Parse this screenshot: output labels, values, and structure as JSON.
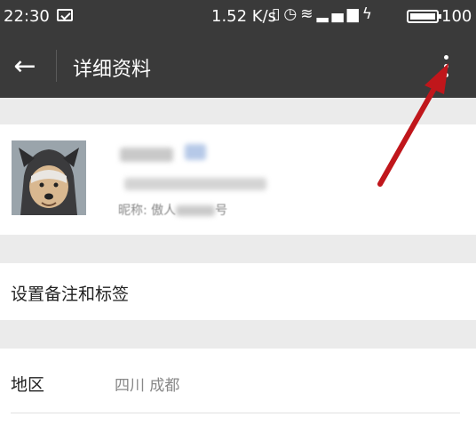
{
  "status_bar": {
    "time": "22:30",
    "net_speed": "1.52 K/s",
    "icons": [
      "vibrate-icon",
      "alarm-icon",
      "wifi-icon",
      "signal-icon",
      "charging-icon"
    ],
    "battery": "100"
  },
  "appbar": {
    "back_icon": "arrow-left-icon",
    "title": "详细资料",
    "more_icon": "more-vertical-icon"
  },
  "profile": {
    "nickname_prefix": "昵称: 傲人",
    "nickname_tail": "号"
  },
  "remark_row": {
    "label": "设置备注和标签"
  },
  "region_row": {
    "label": "地区",
    "value": "四川 成都"
  },
  "annotation": {
    "arrow_color": "#c0161b"
  }
}
